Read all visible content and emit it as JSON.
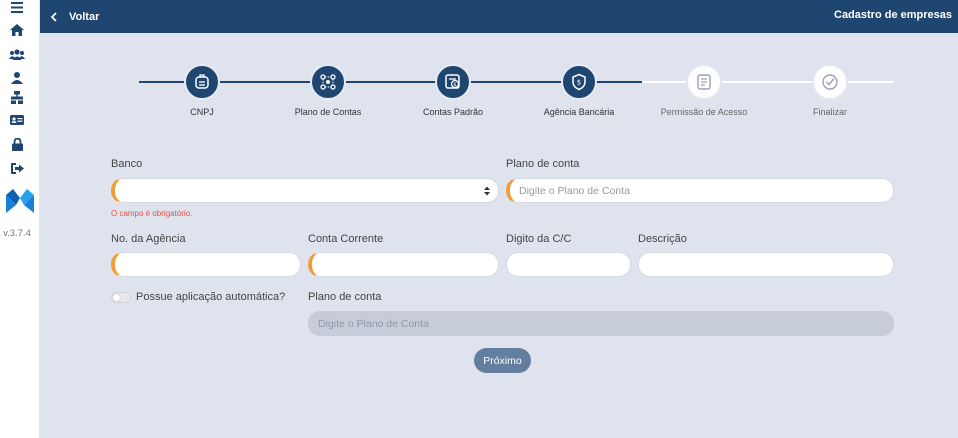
{
  "header": {
    "back_label": "Voltar",
    "title": "Cadastro de empresas"
  },
  "sidebar": {
    "items": [
      {
        "icon": "menu-icon"
      },
      {
        "icon": "home-icon"
      },
      {
        "icon": "users-icon"
      },
      {
        "icon": "user-icon"
      },
      {
        "icon": "org-chart-icon"
      },
      {
        "icon": "id-card-icon"
      },
      {
        "icon": "lock-icon"
      },
      {
        "icon": "logout-icon"
      }
    ],
    "version": "v.3.7.4"
  },
  "stepper": {
    "steps": [
      {
        "label": "CNPJ",
        "icon": "building-icon",
        "status": "done"
      },
      {
        "label": "Plano de Contas",
        "icon": "nodes-icon",
        "status": "done"
      },
      {
        "label": "Contas Padrão",
        "icon": "document-money-icon",
        "status": "done"
      },
      {
        "label": "Agência Bancária",
        "icon": "shield-money-icon",
        "status": "current"
      },
      {
        "label": "Permissão de Acesso",
        "icon": "document-icon",
        "status": "pending"
      },
      {
        "label": "Finalizar",
        "icon": "check-circle-icon",
        "status": "pending"
      }
    ]
  },
  "form": {
    "banco_label": "Banco",
    "banco_value": "",
    "banco_error": "O campo é obrigatório.",
    "plano_label": "Plano de conta",
    "plano_placeholder": "Digite o Plano de Conta",
    "agencia_label": "No. da Agência",
    "conta_label": "Conta Corrente",
    "digito_label": "Digito da C/C",
    "descricao_label": "Descrição",
    "aplicacao_label": "Possue aplicação automática?",
    "aplicacao_on": false,
    "plano2_label": "Plano de conta",
    "plano2_placeholder": "Digite o Plano de Conta",
    "next_label": "Próximo"
  },
  "colors": {
    "primary": "#1f4670",
    "required_accent": "#f29c38",
    "error": "#e0534a",
    "button": "#637e9f",
    "background": "#dfe3ee"
  }
}
